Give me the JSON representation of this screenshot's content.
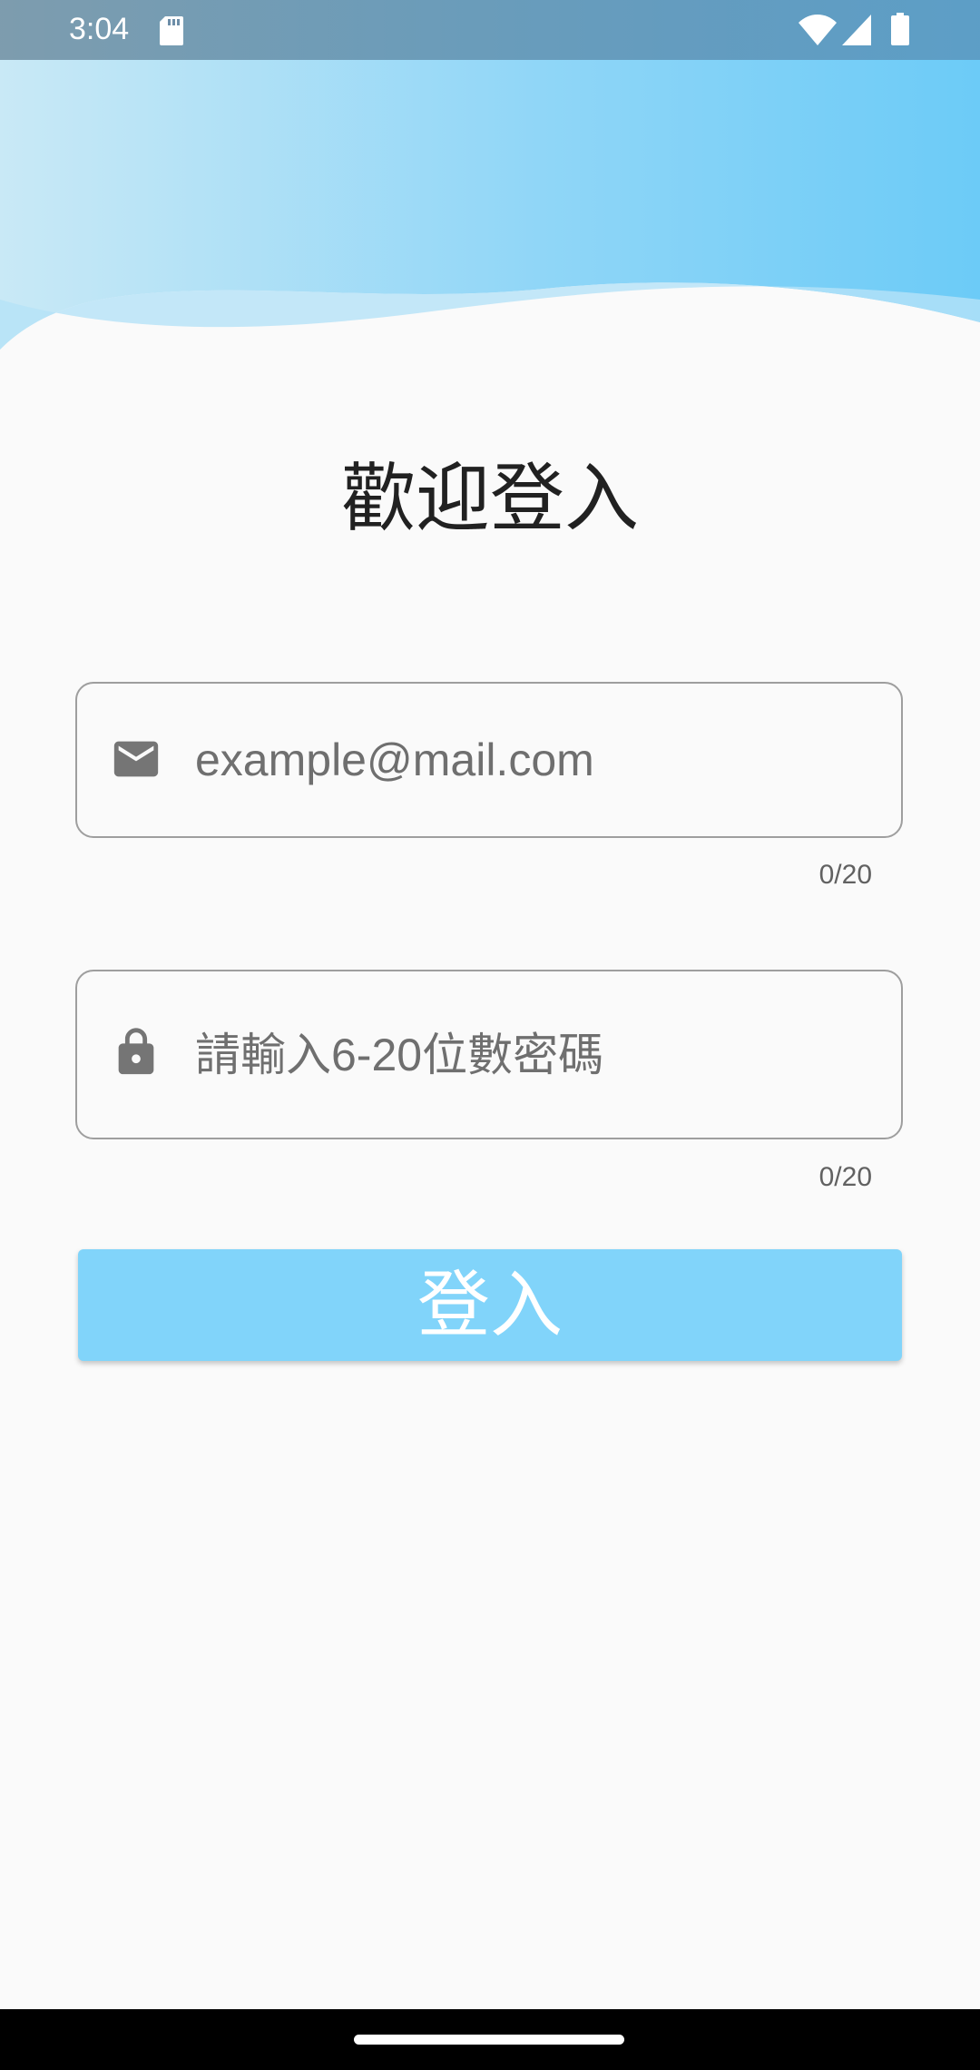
{
  "status_bar": {
    "time": "3:04",
    "icons": [
      "sd-card-icon",
      "wifi-icon",
      "cellular-signal-icon",
      "battery-icon"
    ]
  },
  "header": {
    "wave_colors": [
      "#c9e9f6",
      "#6ccbf7",
      "#a6dcf5"
    ]
  },
  "login": {
    "title": "歡迎登入",
    "email": {
      "icon": "mail-icon",
      "value": "",
      "placeholder": "example@mail.com",
      "counter": "0/20"
    },
    "password": {
      "icon": "lock-icon",
      "value": "",
      "placeholder": "請輸入6-20位數密碼",
      "counter": "0/20"
    },
    "submit_label": "登入"
  },
  "colors": {
    "accent": "#81d4fa",
    "background": "#fafafa",
    "border": "#9e9e9e",
    "icon": "#757575",
    "text": "#212121"
  },
  "nav_bar": {
    "icons": [
      "home-handle"
    ]
  }
}
